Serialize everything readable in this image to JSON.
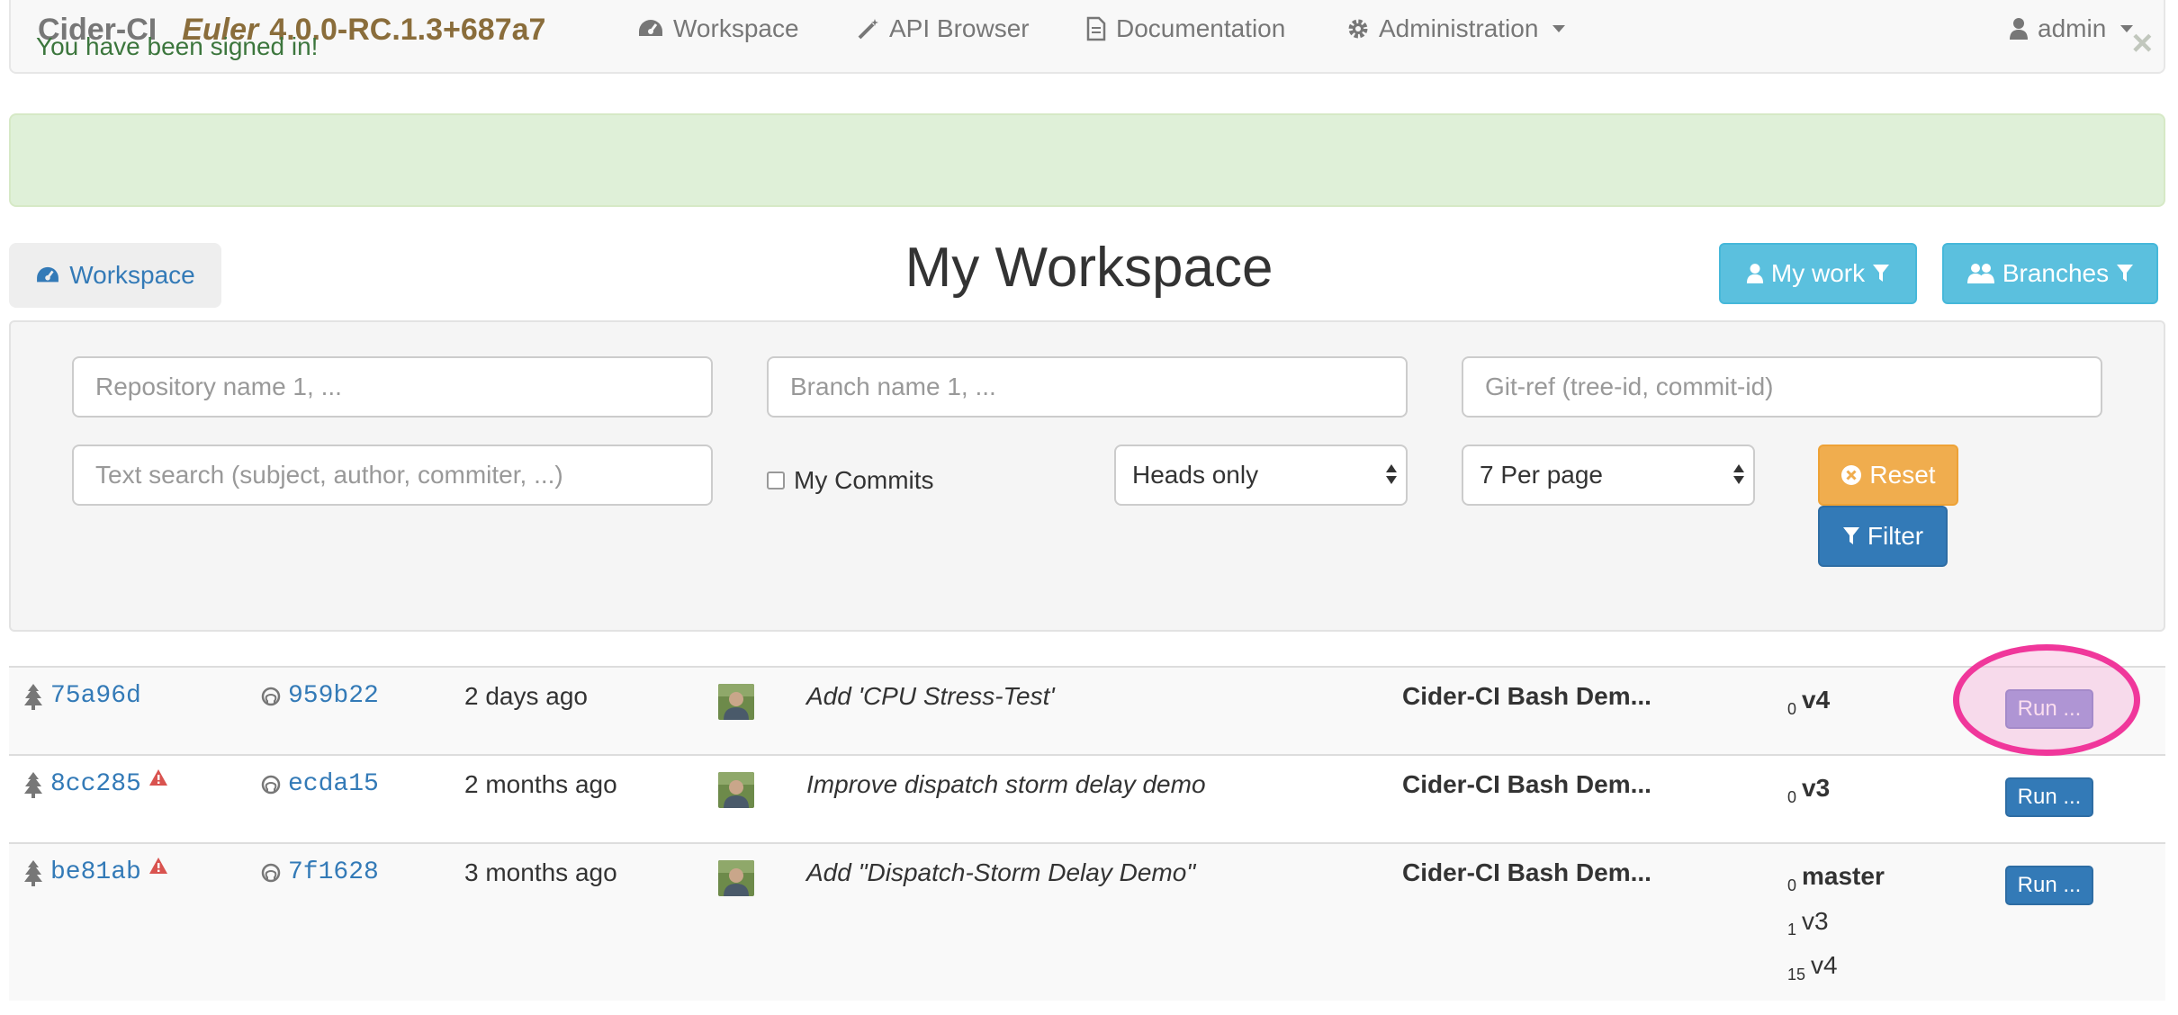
{
  "navbar": {
    "brand": "Cider-CI",
    "release_name": "Euler",
    "version": "4.0.0-RC.1.3+687a7",
    "links": [
      {
        "label": "Workspace",
        "icon": "dashboard-icon"
      },
      {
        "label": "API Browser",
        "icon": "magic-wand-icon"
      },
      {
        "label": "Documentation",
        "icon": "document-icon"
      },
      {
        "label": "Administration",
        "icon": "gear-icon"
      }
    ],
    "user": "admin"
  },
  "alert": {
    "message": "You have been signed in!",
    "close": "×"
  },
  "workspace_tab": "Workspace",
  "page_title": "My Workspace",
  "header_buttons": {
    "my_work": "My work",
    "branches": "Branches"
  },
  "filters": {
    "repository_placeholder": "Repository name 1, ...",
    "branch_placeholder": "Branch name 1, ...",
    "gitref_placeholder": "Git-ref (tree-id, commit-id)",
    "text_search_placeholder": "Text search (subject, author, commiter, ...)",
    "my_commits_label": "My Commits",
    "heads_select": "Heads only",
    "per_page_select": "7 Per page",
    "reset_label": "Reset",
    "filter_label": "Filter"
  },
  "commits": [
    {
      "tree_id": "75a96d",
      "tree_warning": false,
      "commit_id": "959b22",
      "age": "2 days ago",
      "subject": "Add 'CPU Stress-Test'",
      "repository": "Cider-CI Bash Dem...",
      "branches": [
        {
          "distance": "0",
          "name": "v4",
          "bold": true
        }
      ],
      "run_label": "Run ...",
      "highlighted": true
    },
    {
      "tree_id": "8cc285",
      "tree_warning": true,
      "commit_id": "ecda15",
      "age": "2 months ago",
      "subject": "Improve dispatch storm delay demo",
      "repository": "Cider-CI Bash Dem...",
      "branches": [
        {
          "distance": "0",
          "name": "v3",
          "bold": true
        }
      ],
      "run_label": "Run ...",
      "highlighted": false
    },
    {
      "tree_id": "be81ab",
      "tree_warning": true,
      "commit_id": "7f1628",
      "age": "3 months ago",
      "subject": "Add \"Dispatch-Storm Delay Demo\"",
      "repository": "Cider-CI Bash Dem...",
      "branches": [
        {
          "distance": "0",
          "name": "master",
          "bold": true
        },
        {
          "distance": "1",
          "name": "v3",
          "bold": false
        },
        {
          "distance": "15",
          "name": "v4",
          "bold": false
        }
      ],
      "run_label": "Run ...",
      "highlighted": false
    }
  ],
  "colors": {
    "link": "#337ab7",
    "info": "#5bc0de",
    "warning": "#f0ad4e",
    "primary": "#337ab7",
    "annotation": "#f0379b",
    "alert_bg": "#dff0d8",
    "danger": "#d9534f"
  }
}
